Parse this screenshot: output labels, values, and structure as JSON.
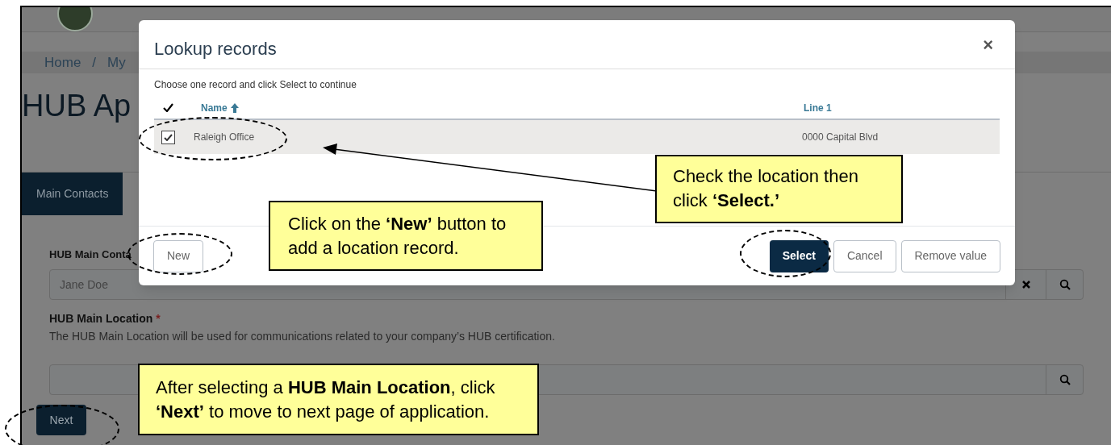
{
  "breadcrumb": [
    "Home",
    "/",
    "My"
  ],
  "heading": "HUB Ap",
  "tabs": [
    {
      "label": "Main Contacts",
      "selected": true
    }
  ],
  "form": {
    "contact_label": "HUB Main Conta",
    "contact_value": "Jane Doe",
    "location_label": "HUB Main Location",
    "required_mark": "*",
    "location_help": "The HUB Main Location will be used for communications related to your company’s HUB certification.",
    "next": "Next"
  },
  "modal": {
    "title": "Lookup records",
    "close": "×",
    "instruction": "Choose one record and click Select to continue",
    "columns": [
      "Name",
      "Line 1"
    ],
    "rows": [
      {
        "name": "Raleigh Office",
        "line_1": "0000 Capital Blvd",
        "checked": true
      }
    ],
    "buttons": [
      {
        "label": "New",
        "kind": "plain"
      },
      {
        "label": "Select",
        "kind": "primary"
      },
      {
        "label": "Cancel",
        "kind": "plain"
      },
      {
        "label": "Remove value",
        "kind": "plain"
      }
    ]
  },
  "callouts": [
    {
      "text": "Check the location then click **‘Select.’**"
    },
    {
      "text": "Click on the **‘New’** button to add a location record."
    },
    {
      "text": "After selecting a **HUB Main Location**, click **‘Next’** to move to next page of application."
    }
  ]
}
